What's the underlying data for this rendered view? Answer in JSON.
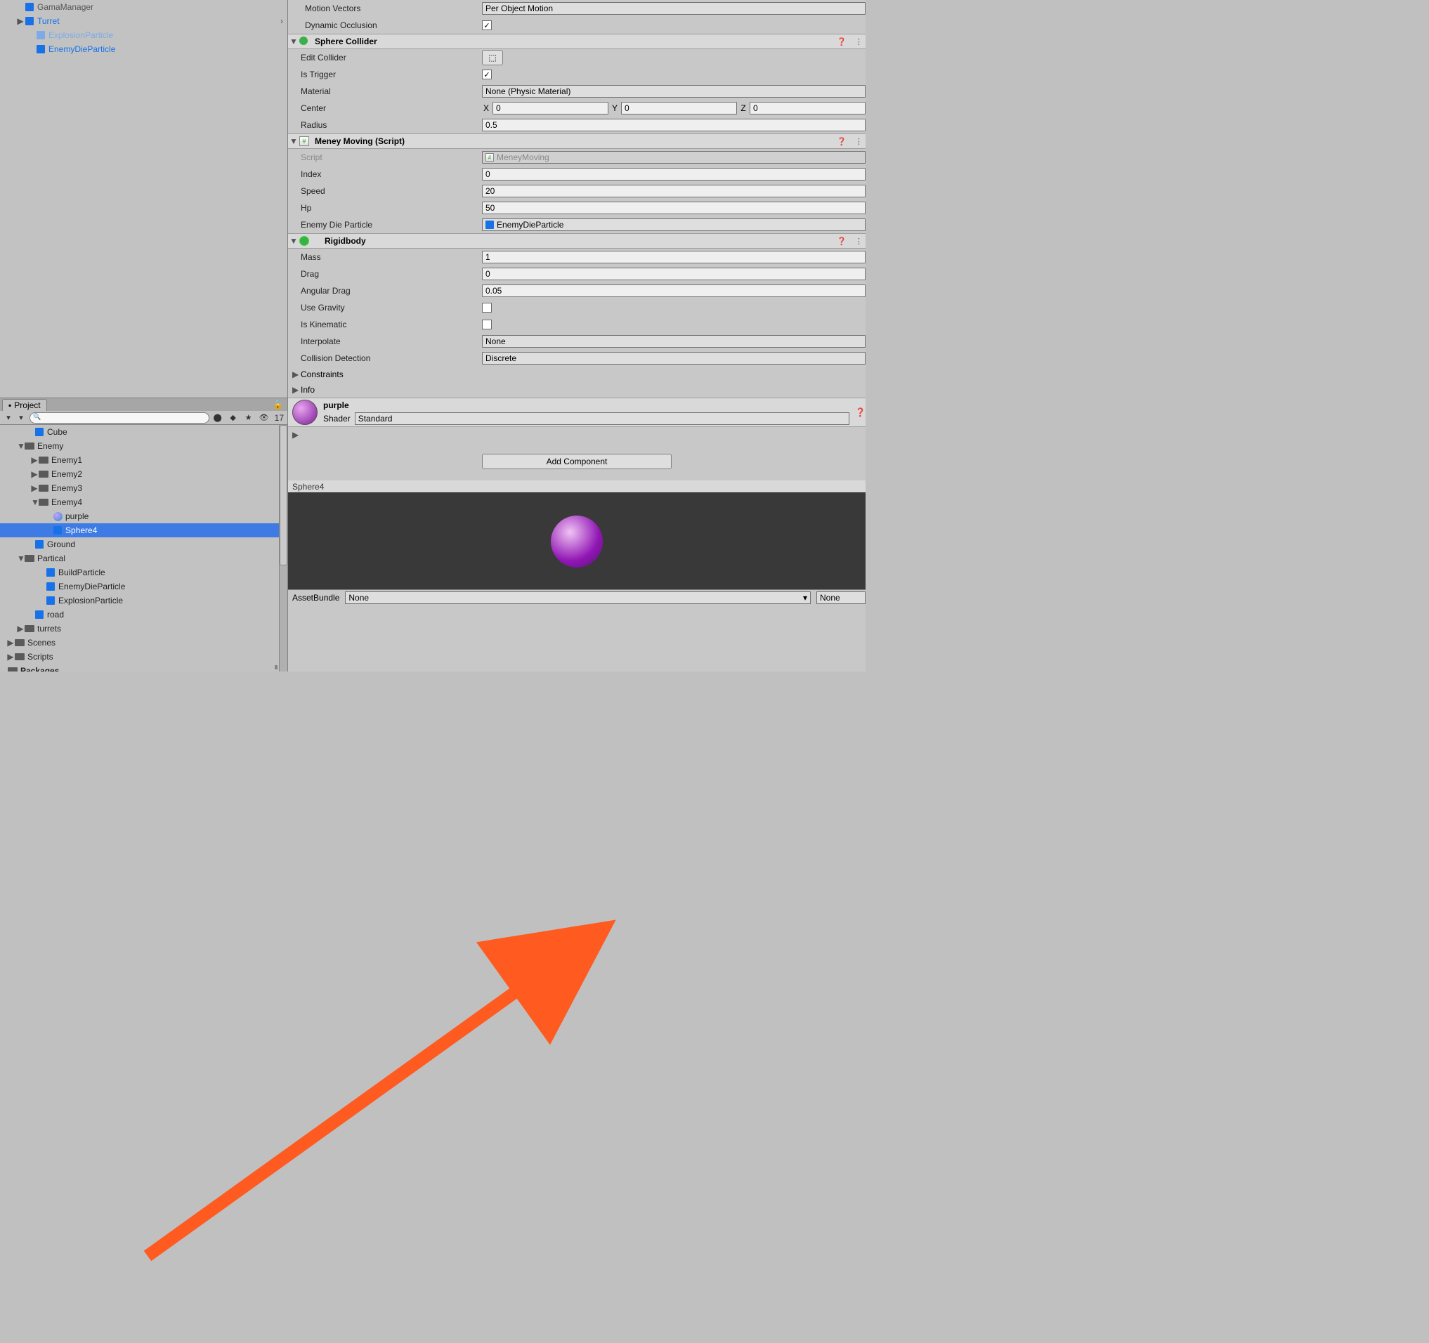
{
  "hierarchy": {
    "items": [
      {
        "label": "GamaManager",
        "icon": "cube",
        "indent": 24,
        "color": "grey"
      },
      {
        "label": "Turret",
        "icon": "cube",
        "indent": 24,
        "arrow": "▶",
        "color": "blue",
        "chev": true
      },
      {
        "label": "ExplosionParticle",
        "icon": "cube-light",
        "indent": 40,
        "color": "light"
      },
      {
        "label": "EnemyDieParticle",
        "icon": "cube",
        "indent": 40,
        "color": "blue"
      }
    ]
  },
  "projectTab": "Project",
  "projectToolbar": {
    "num": "17"
  },
  "project": {
    "items": [
      {
        "label": "Cube",
        "icon": "cube",
        "indent": 38
      },
      {
        "label": "Enemy",
        "icon": "folder",
        "indent": 24,
        "arrow": "▼"
      },
      {
        "label": "Enemy1",
        "icon": "folder",
        "indent": 44,
        "arrow": "▶"
      },
      {
        "label": "Enemy2",
        "icon": "folder",
        "indent": 44,
        "arrow": "▶"
      },
      {
        "label": "Enemy3",
        "icon": "folder",
        "indent": 44,
        "arrow": "▶"
      },
      {
        "label": "Enemy4",
        "icon": "folder",
        "indent": 44,
        "arrow": "▼"
      },
      {
        "label": "purple",
        "icon": "sphere",
        "indent": 64
      },
      {
        "label": "Sphere4",
        "icon": "cube",
        "indent": 64,
        "selected": true
      },
      {
        "label": "Ground",
        "icon": "cube",
        "indent": 38
      },
      {
        "label": "Partical",
        "icon": "folder",
        "indent": 24,
        "arrow": "▼"
      },
      {
        "label": "BuildParticle",
        "icon": "cube",
        "indent": 54
      },
      {
        "label": "EnemyDieParticle",
        "icon": "cube",
        "indent": 54
      },
      {
        "label": "ExplosionParticle",
        "icon": "cube",
        "indent": 54
      },
      {
        "label": "road",
        "icon": "cube",
        "indent": 38
      },
      {
        "label": "turrets",
        "icon": "folder",
        "indent": 24,
        "arrow": "▶"
      },
      {
        "label": "Scenes",
        "icon": "folder",
        "indent": 10,
        "arrow": "▶"
      },
      {
        "label": "Scripts",
        "icon": "folder",
        "indent": 10,
        "arrow": "▶"
      },
      {
        "label": "Packages",
        "icon": "folder-dark",
        "indent": 0,
        "bold": true
      }
    ]
  },
  "inspector": {
    "motionVectors": {
      "label": "Motion Vectors",
      "value": "Per Object Motion"
    },
    "dynamicOcclusion": {
      "label": "Dynamic Occlusion",
      "checked": true
    },
    "sphereCollider": {
      "title": "Sphere Collider",
      "editCollider": "Edit Collider",
      "isTrigger": "Is Trigger",
      "material": {
        "label": "Material",
        "value": "None (Physic Material)"
      },
      "center": {
        "label": "Center",
        "x": "0",
        "y": "0",
        "z": "0"
      },
      "radius": {
        "label": "Radius",
        "value": "0.5"
      }
    },
    "meney": {
      "title": "Meney Moving (Script)",
      "script": {
        "label": "Script",
        "value": "MeneyMoving"
      },
      "index": {
        "label": "Index",
        "value": "0"
      },
      "speed": {
        "label": "Speed",
        "value": "20"
      },
      "hp": {
        "label": "Hp",
        "value": "50"
      },
      "enemyDie": {
        "label": "Enemy Die Particle",
        "value": "EnemyDieParticle"
      }
    },
    "rigidbody": {
      "title": "Rigidbody",
      "mass": {
        "label": "Mass",
        "value": "1"
      },
      "drag": {
        "label": "Drag",
        "value": "0"
      },
      "angularDrag": {
        "label": "Angular Drag",
        "value": "0.05"
      },
      "useGravity": "Use Gravity",
      "isKinematic": "Is Kinematic",
      "interpolate": {
        "label": "Interpolate",
        "value": "None"
      },
      "collisionDetection": {
        "label": "Collision Detection",
        "value": "Discrete"
      },
      "constraints": "Constraints",
      "info": "Info"
    },
    "material": {
      "name": "purple",
      "shaderLabel": "Shader",
      "shader": "Standard"
    },
    "addComponent": "Add Component",
    "previewName": "Sphere4",
    "assetBundleLabel": "AssetBundle",
    "assetBundleLeft": "None",
    "assetBundleRight": "None"
  }
}
